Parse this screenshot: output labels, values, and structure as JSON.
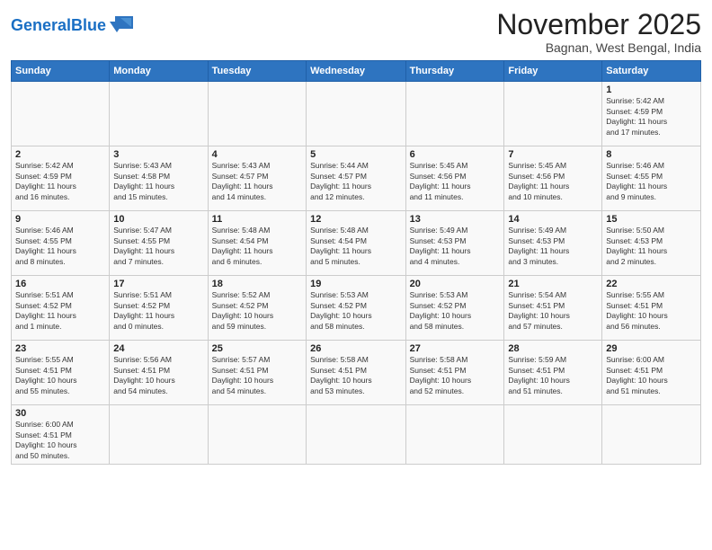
{
  "logo": {
    "text_general": "General",
    "text_blue": "Blue"
  },
  "title": "November 2025",
  "subtitle": "Bagnan, West Bengal, India",
  "days_of_week": [
    "Sunday",
    "Monday",
    "Tuesday",
    "Wednesday",
    "Thursday",
    "Friday",
    "Saturday"
  ],
  "weeks": [
    [
      {
        "day": "",
        "info": ""
      },
      {
        "day": "",
        "info": ""
      },
      {
        "day": "",
        "info": ""
      },
      {
        "day": "",
        "info": ""
      },
      {
        "day": "",
        "info": ""
      },
      {
        "day": "",
        "info": ""
      },
      {
        "day": "1",
        "info": "Sunrise: 5:42 AM\nSunset: 4:59 PM\nDaylight: 11 hours\nand 17 minutes."
      }
    ],
    [
      {
        "day": "2",
        "info": "Sunrise: 5:42 AM\nSunset: 4:59 PM\nDaylight: 11 hours\nand 16 minutes."
      },
      {
        "day": "3",
        "info": "Sunrise: 5:43 AM\nSunset: 4:58 PM\nDaylight: 11 hours\nand 15 minutes."
      },
      {
        "day": "4",
        "info": "Sunrise: 5:43 AM\nSunset: 4:57 PM\nDaylight: 11 hours\nand 14 minutes."
      },
      {
        "day": "5",
        "info": "Sunrise: 5:44 AM\nSunset: 4:57 PM\nDaylight: 11 hours\nand 12 minutes."
      },
      {
        "day": "6",
        "info": "Sunrise: 5:45 AM\nSunset: 4:56 PM\nDaylight: 11 hours\nand 11 minutes."
      },
      {
        "day": "7",
        "info": "Sunrise: 5:45 AM\nSunset: 4:56 PM\nDaylight: 11 hours\nand 10 minutes."
      },
      {
        "day": "8",
        "info": "Sunrise: 5:46 AM\nSunset: 4:55 PM\nDaylight: 11 hours\nand 9 minutes."
      }
    ],
    [
      {
        "day": "9",
        "info": "Sunrise: 5:46 AM\nSunset: 4:55 PM\nDaylight: 11 hours\nand 8 minutes."
      },
      {
        "day": "10",
        "info": "Sunrise: 5:47 AM\nSunset: 4:55 PM\nDaylight: 11 hours\nand 7 minutes."
      },
      {
        "day": "11",
        "info": "Sunrise: 5:48 AM\nSunset: 4:54 PM\nDaylight: 11 hours\nand 6 minutes."
      },
      {
        "day": "12",
        "info": "Sunrise: 5:48 AM\nSunset: 4:54 PM\nDaylight: 11 hours\nand 5 minutes."
      },
      {
        "day": "13",
        "info": "Sunrise: 5:49 AM\nSunset: 4:53 PM\nDaylight: 11 hours\nand 4 minutes."
      },
      {
        "day": "14",
        "info": "Sunrise: 5:49 AM\nSunset: 4:53 PM\nDaylight: 11 hours\nand 3 minutes."
      },
      {
        "day": "15",
        "info": "Sunrise: 5:50 AM\nSunset: 4:53 PM\nDaylight: 11 hours\nand 2 minutes."
      }
    ],
    [
      {
        "day": "16",
        "info": "Sunrise: 5:51 AM\nSunset: 4:52 PM\nDaylight: 11 hours\nand 1 minute."
      },
      {
        "day": "17",
        "info": "Sunrise: 5:51 AM\nSunset: 4:52 PM\nDaylight: 11 hours\nand 0 minutes."
      },
      {
        "day": "18",
        "info": "Sunrise: 5:52 AM\nSunset: 4:52 PM\nDaylight: 10 hours\nand 59 minutes."
      },
      {
        "day": "19",
        "info": "Sunrise: 5:53 AM\nSunset: 4:52 PM\nDaylight: 10 hours\nand 58 minutes."
      },
      {
        "day": "20",
        "info": "Sunrise: 5:53 AM\nSunset: 4:52 PM\nDaylight: 10 hours\nand 58 minutes."
      },
      {
        "day": "21",
        "info": "Sunrise: 5:54 AM\nSunset: 4:51 PM\nDaylight: 10 hours\nand 57 minutes."
      },
      {
        "day": "22",
        "info": "Sunrise: 5:55 AM\nSunset: 4:51 PM\nDaylight: 10 hours\nand 56 minutes."
      }
    ],
    [
      {
        "day": "23",
        "info": "Sunrise: 5:55 AM\nSunset: 4:51 PM\nDaylight: 10 hours\nand 55 minutes."
      },
      {
        "day": "24",
        "info": "Sunrise: 5:56 AM\nSunset: 4:51 PM\nDaylight: 10 hours\nand 54 minutes."
      },
      {
        "day": "25",
        "info": "Sunrise: 5:57 AM\nSunset: 4:51 PM\nDaylight: 10 hours\nand 54 minutes."
      },
      {
        "day": "26",
        "info": "Sunrise: 5:58 AM\nSunset: 4:51 PM\nDaylight: 10 hours\nand 53 minutes."
      },
      {
        "day": "27",
        "info": "Sunrise: 5:58 AM\nSunset: 4:51 PM\nDaylight: 10 hours\nand 52 minutes."
      },
      {
        "day": "28",
        "info": "Sunrise: 5:59 AM\nSunset: 4:51 PM\nDaylight: 10 hours\nand 51 minutes."
      },
      {
        "day": "29",
        "info": "Sunrise: 6:00 AM\nSunset: 4:51 PM\nDaylight: 10 hours\nand 51 minutes."
      }
    ],
    [
      {
        "day": "30",
        "info": "Sunrise: 6:00 AM\nSunset: 4:51 PM\nDaylight: 10 hours\nand 50 minutes."
      },
      {
        "day": "",
        "info": ""
      },
      {
        "day": "",
        "info": ""
      },
      {
        "day": "",
        "info": ""
      },
      {
        "day": "",
        "info": ""
      },
      {
        "day": "",
        "info": ""
      },
      {
        "day": "",
        "info": ""
      }
    ]
  ]
}
